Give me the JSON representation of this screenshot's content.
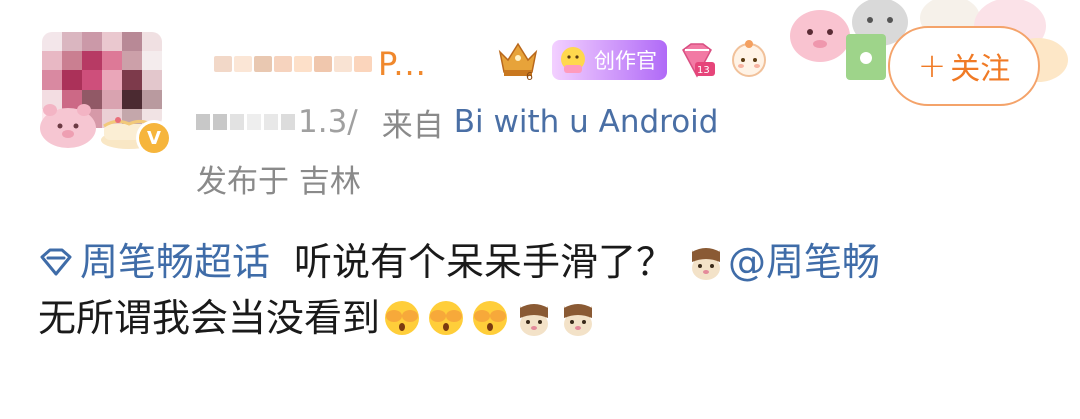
{
  "user": {
    "name_visible_suffix": "P...",
    "avatar_colors": [
      "#f3e6ea",
      "#d9b6c0",
      "#c99aa8",
      "#e9c8cf",
      "#b68a96",
      "#efe0e2",
      "#e6b9c4",
      "#c78091",
      "#b23b63",
      "#d97a97",
      "#caa0a9",
      "#f4eced",
      "#d68aa1",
      "#a73258",
      "#c9507a",
      "#e8a7b9",
      "#7b3b4b",
      "#e2c7cc",
      "#f2dde2",
      "#c86a86",
      "#8f5a66",
      "#d7a4b0",
      "#4a2a31",
      "#b89a9f",
      "#fde9ee",
      "#f1c7d1",
      "#d49aa8",
      "#ead0d5",
      "#c3a7ab",
      "#f0e3e4"
    ],
    "name_blur_colors": [
      "#f2d8c8",
      "#fbe6d6",
      "#e9c8b1",
      "#f6d3be",
      "#fde0c9",
      "#f0c7ad",
      "#f9e3d3",
      "#fbd5bc"
    ],
    "creator_badge_label": "创作官",
    "level": "13",
    "crown_level": "6"
  },
  "follow_button": {
    "label": "关注",
    "plus": "+"
  },
  "meta": {
    "time_visible": "1.3/",
    "source_prefix": "来自",
    "source_name": "Bi with u Android",
    "location": "发布于 吉林"
  },
  "post": {
    "topic": "周笔畅超话",
    "line1_text": "听说有个呆呆手滑了？",
    "mention": "@周笔畅",
    "line2_text": "无所谓我会当没看到"
  },
  "colors": {
    "accent_orange": "#f07a25",
    "link_blue": "#3f6ca8",
    "meta_gray": "#8a8a8a"
  },
  "icons": {
    "emoji_cover_eyes": "see-no-evil-emoji",
    "emoji_cat": "cat-face-emoji",
    "topic": "super-topic-diamond-icon"
  }
}
